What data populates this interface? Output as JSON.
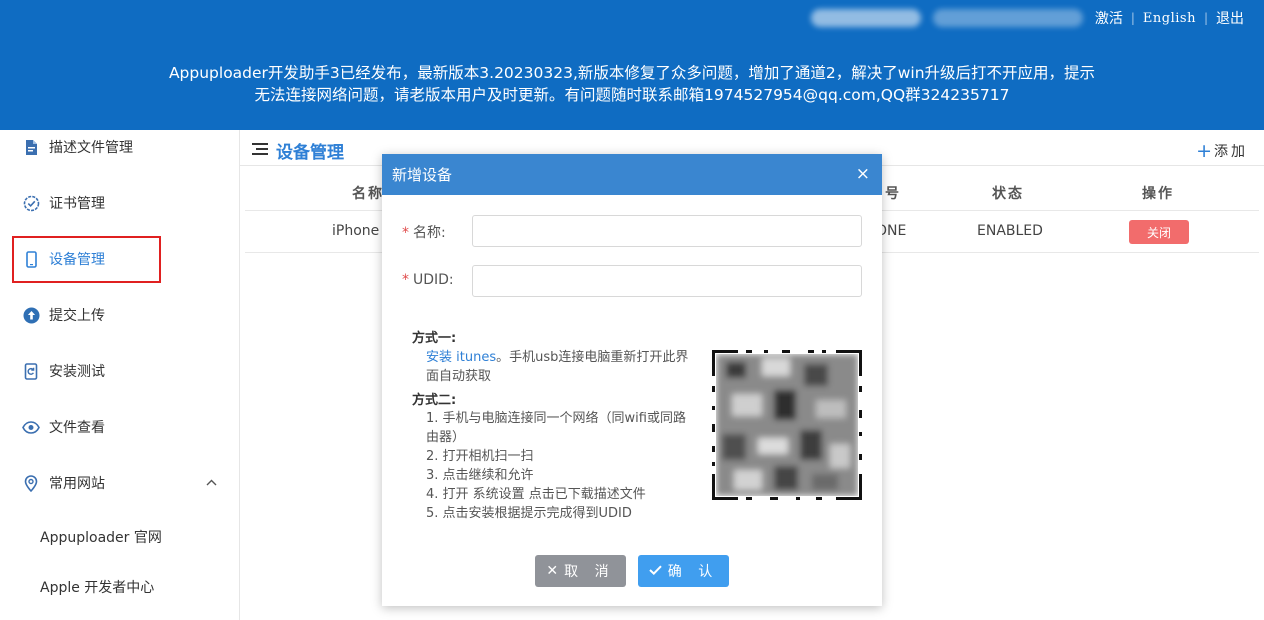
{
  "header": {
    "links": {
      "activate": "激活",
      "english": "English",
      "logout": "退出"
    },
    "announcement_line1": "Appuploader开发助手3已经发布，最新版本3.20230323,新版本修复了众多问题，增加了通道2，解决了win升级后打不开应用，提示",
    "announcement_line2": "无法连接网络问题，请老版本用户及时更新。有问题随时联系邮箱1974527954@qq.com,QQ群324235717"
  },
  "sidebar": {
    "items": [
      {
        "label": "描述文件管理",
        "icon": "file-icon"
      },
      {
        "label": "证书管理",
        "icon": "certificate-icon"
      },
      {
        "label": "设备管理",
        "icon": "phone-icon",
        "active": true
      },
      {
        "label": "提交上传",
        "icon": "upload-icon"
      },
      {
        "label": "安装测试",
        "icon": "install-icon"
      },
      {
        "label": "文件查看",
        "icon": "eye-icon"
      },
      {
        "label": "常用网站",
        "icon": "location-icon",
        "expanded": true
      }
    ],
    "sub_items": [
      "Appuploader 官网",
      "Apple 开发者中心"
    ]
  },
  "main": {
    "title": "设备管理",
    "add_label": "添加",
    "columns": [
      "名称",
      "号",
      "状态",
      "操作"
    ],
    "rows": [
      {
        "name": "iPhone",
        "type": "ONE",
        "status": "ENABLED",
        "action": "关闭"
      }
    ]
  },
  "modal": {
    "title": "新增设备",
    "name_label": "名称:",
    "udid_label": "UDID:",
    "name_value": "",
    "udid_value": "",
    "method1_title": "方式一:",
    "method1_link": "安装 itunes",
    "method1_text": "。手机usb连接电脑重新打开此界面自动获取",
    "method2_title": "方式二:",
    "method2_steps": [
      "1. 手机与电脑连接同一个网络（同wifi或同路由器）",
      "2. 打开相机扫一扫",
      "3. 点击继续和允许",
      "4. 打开 系统设置 点击已下载描述文件",
      "5. 点击安装根据提示完成得到UDID"
    ],
    "cancel_label": "取 消",
    "confirm_label": "确 认"
  },
  "colors": {
    "header_bg": "#0f6cc2",
    "accent": "#2f80d6",
    "modal_header": "#3a86d0",
    "danger": "#f26c6c",
    "highlight_box": "#e02020"
  }
}
